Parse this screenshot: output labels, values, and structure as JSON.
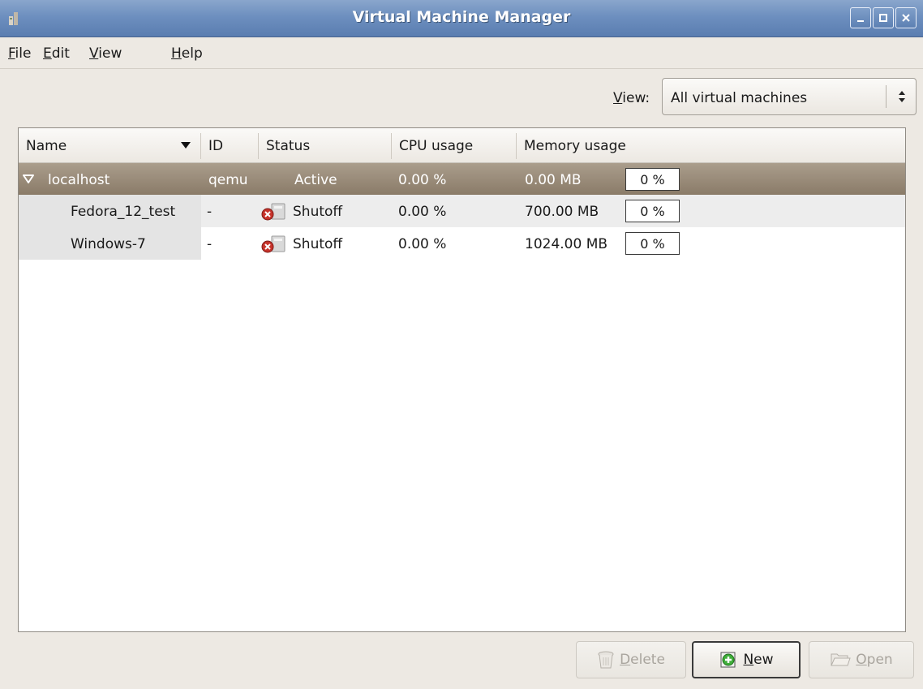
{
  "window": {
    "title": "Virtual Machine Manager"
  },
  "menubar": [
    {
      "label": "File",
      "mnemonic": "F",
      "rest": "ile"
    },
    {
      "label": "Edit",
      "mnemonic": "E",
      "rest": "dit"
    },
    {
      "label": "View",
      "mnemonic": "V",
      "rest": "iew"
    },
    {
      "label": "Help",
      "mnemonic": "H",
      "rest": "elp"
    }
  ],
  "view_filter": {
    "label_mnemonic": "V",
    "label_rest": "iew:",
    "selected": "All virtual machines"
  },
  "columns": [
    "Name",
    "ID",
    "Status",
    "CPU usage",
    "Memory usage"
  ],
  "host": {
    "name": "localhost",
    "id": "qemu",
    "status": "Active",
    "cpu": "0.00 %",
    "memory": "0.00 MB",
    "memory_pct": "0 %"
  },
  "vms": [
    {
      "name": "Fedora_12_test",
      "id": "-",
      "status": "Shutoff",
      "cpu": "0.00 %",
      "memory": "700.00 MB",
      "memory_pct": "0 %"
    },
    {
      "name": "Windows-7",
      "id": "-",
      "status": "Shutoff",
      "cpu": "0.00 %",
      "memory": "1024.00 MB",
      "memory_pct": "0 %"
    }
  ],
  "buttons": {
    "delete": {
      "mnemonic": "D",
      "rest": "elete",
      "enabled": false
    },
    "new": {
      "mnemonic": "N",
      "rest": "ew",
      "enabled": true
    },
    "open": {
      "mnemonic": "O",
      "rest": "pen",
      "enabled": false
    }
  }
}
